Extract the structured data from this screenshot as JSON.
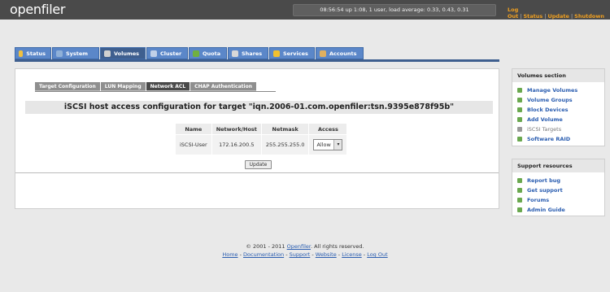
{
  "app": {
    "logo": "openfiler"
  },
  "header": {
    "sysinfo": "08:56:54 up 1:08, 1 user, load average: 0.33, 0.43, 0.31",
    "links": [
      "Log Out",
      "Status",
      "Update",
      "Shutdown"
    ]
  },
  "tabs": [
    {
      "label": "Status",
      "icon": "status-icon",
      "color": "#f0c040"
    },
    {
      "label": "System",
      "icon": "system-icon",
      "color": "#8fb0d8"
    },
    {
      "label": "Volumes",
      "icon": "volumes-icon",
      "color": "#d0d0d0",
      "active": true
    },
    {
      "label": "Cluster",
      "icon": "cluster-icon",
      "color": "#c0d0e8"
    },
    {
      "label": "Quota",
      "icon": "quota-icon",
      "color": "#70b040"
    },
    {
      "label": "Shares",
      "icon": "shares-icon",
      "color": "#d8d8d8"
    },
    {
      "label": "Services",
      "icon": "services-icon",
      "color": "#f0c030"
    },
    {
      "label": "Accounts",
      "icon": "accounts-icon",
      "color": "#e0b060"
    }
  ],
  "subtabs": [
    {
      "label": "Target Configuration"
    },
    {
      "label": "LUN Mapping"
    },
    {
      "label": "Network ACL",
      "active": true
    },
    {
      "label": "CHAP Authentication"
    }
  ],
  "main": {
    "title": "iSCSI host access configuration for target \"iqn.2006-01.com.openfiler:tsn.9395e878f95b\"",
    "table": {
      "headers": [
        "Name",
        "Network/Host",
        "Netmask",
        "Access"
      ],
      "rows": [
        {
          "name": "iSCSI-User",
          "host": "172.16.200.5",
          "netmask": "255.255.255.0",
          "access": "Allow"
        }
      ]
    },
    "update_label": "Update"
  },
  "volumes_section": {
    "title": "Volumes section",
    "items": [
      {
        "label": "Manage Volumes",
        "icon": "manage-volumes-icon"
      },
      {
        "label": "Volume Groups",
        "icon": "volume-groups-icon"
      },
      {
        "label": "Block Devices",
        "icon": "block-devices-icon"
      },
      {
        "label": "Add Volume",
        "icon": "add-volume-icon"
      },
      {
        "label": "iSCSI Targets",
        "icon": "iscsi-targets-icon",
        "current": true
      },
      {
        "label": "Software RAID",
        "icon": "software-raid-icon"
      }
    ]
  },
  "support_section": {
    "title": "Support resources",
    "items": [
      {
        "label": "Report bug",
        "icon": "report-bug-icon"
      },
      {
        "label": "Get support",
        "icon": "get-support-icon"
      },
      {
        "label": "Forums",
        "icon": "forums-icon"
      },
      {
        "label": "Admin Guide",
        "icon": "admin-guide-icon"
      }
    ]
  },
  "footer": {
    "copyright": "© 2001 - 2011 ",
    "brand": "Openfiler",
    "rights": ". All rights reserved.",
    "links": [
      "Home",
      "Documentation",
      "Support",
      "Website",
      "License",
      "Log Out"
    ]
  }
}
